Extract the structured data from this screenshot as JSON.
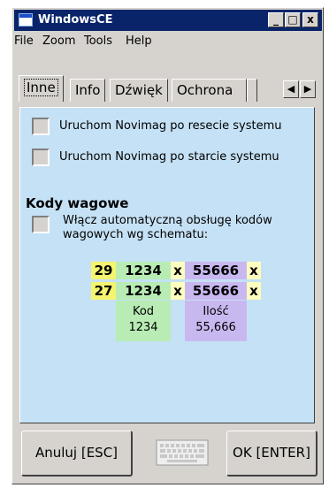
{
  "window": {
    "title": "WindowsCE",
    "minimize": "_",
    "maximize": "□",
    "close": "x"
  },
  "menu": [
    "File",
    "Zoom",
    "Tools",
    "Help"
  ],
  "tabs": [
    "Inne",
    "Info",
    "Dźwięk",
    "Ochrona"
  ],
  "tab_scroll": {
    "left": "◀",
    "right": "▶"
  },
  "options": {
    "reset": "Uruchom Novimag po resecie systemu",
    "start": "Uruchom Novimag po starcie systemu"
  },
  "weight_codes": {
    "title": "Kody wagowe",
    "enable_line1": "Włącz automatyczną obsługę kodów",
    "enable_line2": "wagowych wg schematu:",
    "row1": {
      "prefix": "29",
      "code": "1234",
      "sep1": "x",
      "qty": "55666",
      "sep2": "x"
    },
    "row2": {
      "prefix": "27",
      "code": "1234",
      "sep1": "x",
      "qty": "55666",
      "sep2": "x"
    },
    "code_label": "Kod",
    "code_value": "1234",
    "qty_label": "Ilość",
    "qty_value": "55,666"
  },
  "buttons": {
    "cancel": "Anuluj [ESC]",
    "ok": "OK [ENTER]"
  },
  "colors": {
    "titlebar": "#0a246a",
    "panel": "#c5e1f5",
    "prefix": "#f4f470",
    "code": "#b8ecb4",
    "qty": "#c9b8f0"
  }
}
